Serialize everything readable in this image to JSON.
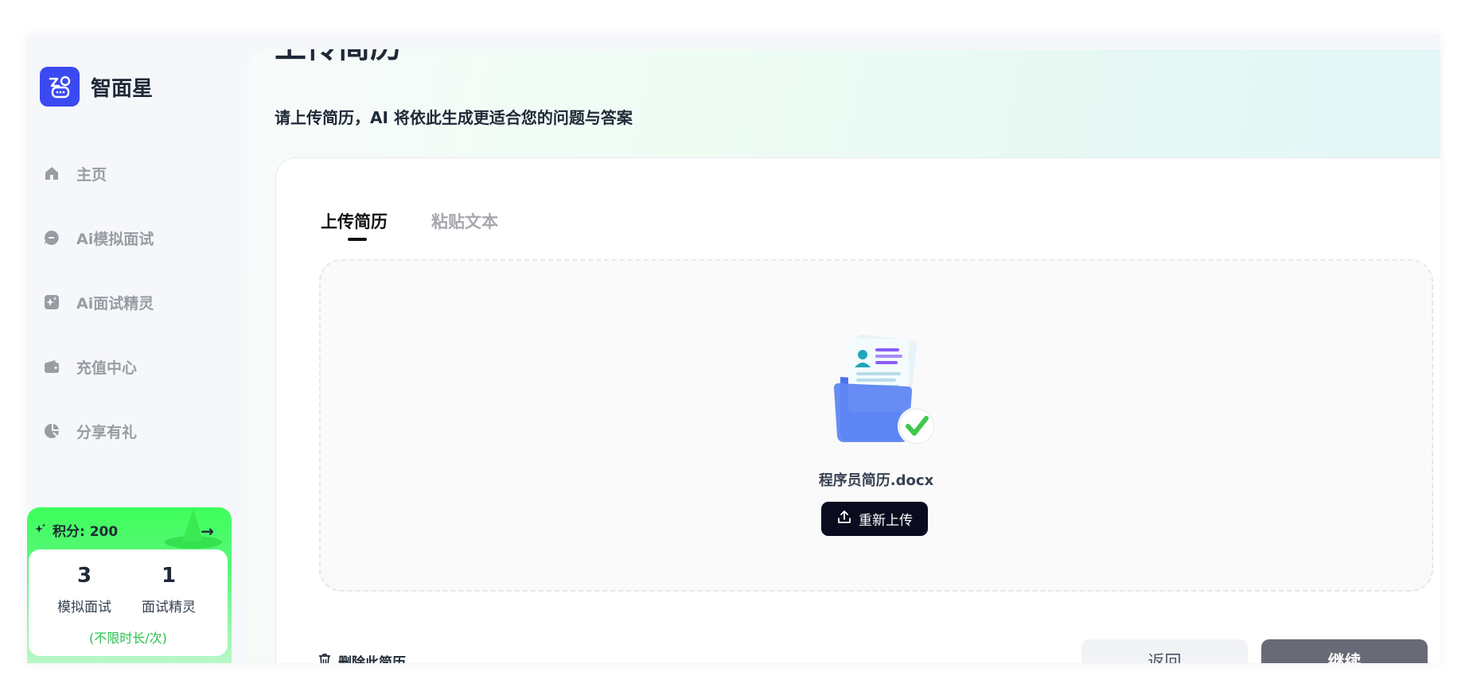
{
  "app": {
    "brand": "智面星"
  },
  "sidebar": {
    "items": [
      {
        "label": "主页",
        "icon": "home-icon"
      },
      {
        "label": "Ai模拟面试",
        "icon": "chat-bubble-icon"
      },
      {
        "label": "Ai面试精灵",
        "icon": "sparkle-icon"
      },
      {
        "label": "充值中心",
        "icon": "wallet-icon"
      },
      {
        "label": "分享有礼",
        "icon": "share-icon"
      }
    ]
  },
  "points": {
    "label": "积分: 200",
    "stats": [
      {
        "value": "3",
        "label": "模拟面试"
      },
      {
        "value": "1",
        "label": "面试精灵"
      }
    ],
    "note": "(不限时长/次)"
  },
  "main": {
    "title": "上传简历",
    "subtitle": "请上传简历，AI 将依此生成更适合您的问题与答案",
    "tabs": [
      {
        "label": "上传简历",
        "active": true
      },
      {
        "label": "粘贴文本",
        "active": false
      }
    ],
    "upload": {
      "file_name": "程序员简历.docx",
      "reupload_label": "重新上传"
    },
    "delete_label": "删除此简历",
    "back_label": "返回",
    "continue_label": "继续"
  },
  "colors": {
    "brand": "#3b49f2",
    "points_green": "#3dff5a",
    "check_green": "#3ec84e",
    "continue_bg": "#686a76"
  }
}
